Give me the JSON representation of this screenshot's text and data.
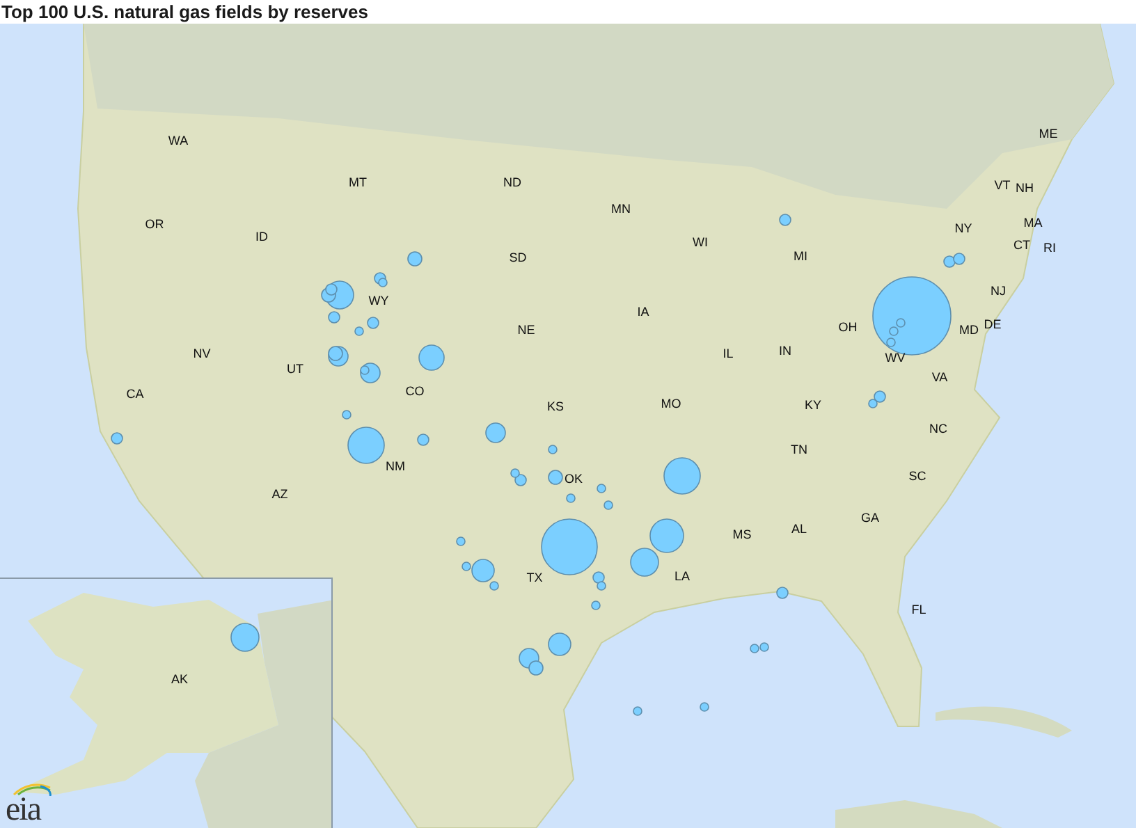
{
  "title": "Top 100 U.S. natural gas fields by reserves",
  "map": {
    "state_labels": [
      "WA",
      "ME",
      "MT",
      "ND",
      "VT",
      "NH",
      "MN",
      "OR",
      "NY",
      "MA",
      "ID",
      "WI",
      "CT",
      "RI",
      "SD",
      "MI",
      "NJ",
      "WY",
      "IA",
      "NE",
      "OH",
      "MD",
      "DE",
      "NV",
      "IL",
      "IN",
      "WV",
      "UT",
      "VA",
      "CA",
      "CO",
      "KS",
      "MO",
      "KY",
      "NC",
      "TN",
      "NM",
      "OK",
      "SC",
      "AZ",
      "MS",
      "AL",
      "GA",
      "TX",
      "LA",
      "FL"
    ]
  },
  "inset": {
    "state_labels": [
      "AK"
    ]
  },
  "logo": {
    "text": "eia"
  }
}
